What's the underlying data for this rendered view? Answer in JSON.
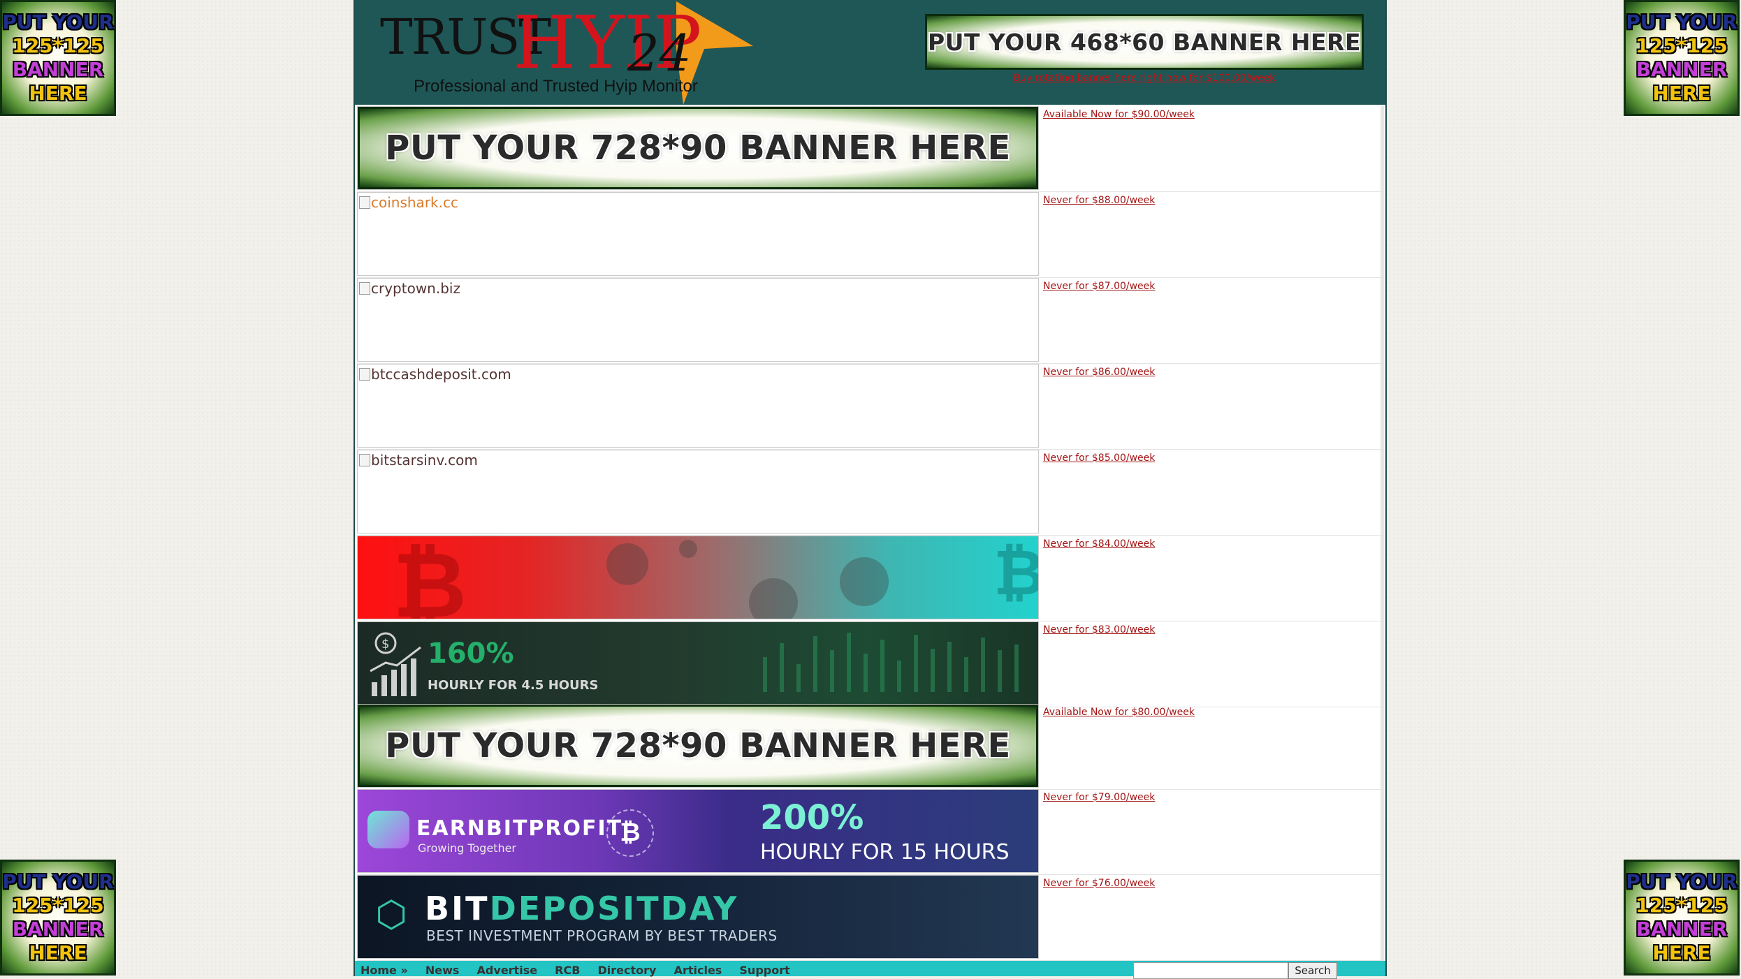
{
  "corner_ads": {
    "lines": [
      "PUT YOUR",
      "125*125",
      "BANNER",
      "HERE"
    ]
  },
  "header": {
    "logo": {
      "word1": "TRUST",
      "word2": "HYIP",
      "number": "24",
      "tagline": "Professional and Trusted Hyip Monitor",
      "colors": {
        "accent_h": "#d4141c",
        "arrow": "#f29a1a"
      }
    },
    "banner_text": "PUT YOUR 468*60 BANNER HERE",
    "banner_link": "Buy rotating banner here right now for $100.00/week"
  },
  "rows": [
    {
      "kind": "placeholder",
      "banner_text": "PUT YOUR 728*90 BANNER HERE",
      "price": "Available Now for $90.00/week"
    },
    {
      "kind": "broken",
      "alt": "coinshark.cc",
      "alt_style": "orange",
      "price": "Never for $88.00/week"
    },
    {
      "kind": "broken",
      "alt": "cryptown.biz",
      "alt_style": "dark",
      "price": "Never for $87.00/week"
    },
    {
      "kind": "broken",
      "alt": "btccashdeposit.com",
      "alt_style": "dark",
      "price": "Never for $86.00/week"
    },
    {
      "kind": "broken",
      "alt": "bitstarsinv.com",
      "alt_style": "dark",
      "price": "Never for $85.00/week"
    },
    {
      "kind": "image-red",
      "price": "Never for $84.00/week"
    },
    {
      "kind": "image-green",
      "headline": "160%",
      "subline": "HOURLY FOR 4.5 HOURS",
      "price": "Never for $83.00/week"
    },
    {
      "kind": "placeholder",
      "banner_text": "PUT YOUR 728*90 BANNER HERE",
      "price": "Available Now for $80.00/week"
    },
    {
      "kind": "image-purple",
      "brand": "EARNBITPROFIT",
      "tagline": "Growing Together",
      "headline": "200%",
      "subline": "HOURLY FOR 15 HOURS",
      "price": "Never for $79.00/week"
    },
    {
      "kind": "image-dark",
      "brand_a": "BIT",
      "brand_b": "DEPOSITDAY",
      "tagline": "BEST INVESTMENT PROGRAM BY BEST TRADERS",
      "price": "Never for $76.00/week"
    }
  ],
  "nav": {
    "items": [
      "Home »",
      "News",
      "Advertise",
      "RCB",
      "Directory",
      "Articles",
      "Support"
    ],
    "search_placeholder": "",
    "search_button": "Search"
  },
  "colors": {
    "header_bg": "#1f5757",
    "nav_bg": "#23c4c4",
    "link": "#a31515"
  }
}
